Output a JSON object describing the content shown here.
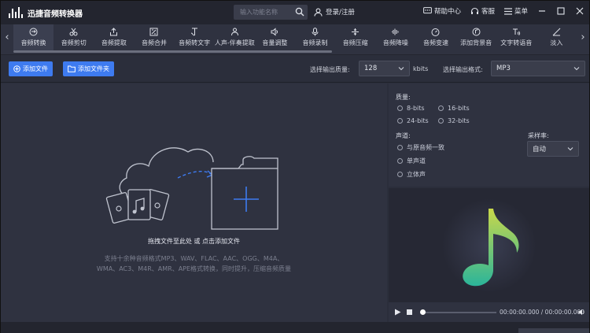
{
  "app": {
    "title": "迅捷音频转换器"
  },
  "search": {
    "placeholder": "输入功能名称"
  },
  "login": {
    "label": "登录/注册"
  },
  "titlebar": {
    "help": "帮助中心",
    "service": "客服",
    "menu": "菜单"
  },
  "tabs": [
    {
      "label": "音频转换",
      "icon": "convert-icon"
    },
    {
      "label": "音频剪切",
      "icon": "scissors-icon"
    },
    {
      "label": "音频提取",
      "icon": "extract-icon"
    },
    {
      "label": "音频合并",
      "icon": "merge-icon"
    },
    {
      "label": "音频转文字",
      "icon": "text-icon"
    },
    {
      "label": "人声-伴奏提取",
      "icon": "vocal-icon"
    },
    {
      "label": "音量调整",
      "icon": "volume-icon"
    },
    {
      "label": "音频录制",
      "icon": "mic-icon"
    },
    {
      "label": "音频压缩",
      "icon": "compress-icon"
    },
    {
      "label": "音频降噪",
      "icon": "denoise-icon"
    },
    {
      "label": "音频变速",
      "icon": "speed-icon"
    },
    {
      "label": "添加背景音",
      "icon": "bgm-icon"
    },
    {
      "label": "文字转语音",
      "icon": "tts-icon"
    },
    {
      "label": "淡入",
      "icon": "fade-icon"
    }
  ],
  "actions": {
    "add_file": "添加文件",
    "add_folder": "添加文件夹"
  },
  "output": {
    "quality_label": "选择输出质量:",
    "quality_value": "128",
    "quality_unit": "kbits",
    "format_label": "选择输出格式:",
    "format_value": "MP3"
  },
  "dropzone": {
    "hint": "拖拽文件至此处 或 点击添加文件",
    "desc_line1": "支持十余种音频格式MP3、WAV、FLAC、AAC、OGG、M4A、",
    "desc_line2": "WMA、AC3、M4R、AMR、APE格式转换，同时提升，压缩音频质量"
  },
  "settings": {
    "quality_title": "质量:",
    "quality_options": [
      "8-bits",
      "16-bits",
      "24-bits",
      "32-bits"
    ],
    "channel_title": "声道:",
    "channel_options": [
      "与原音频一致",
      "单声道",
      "立体声"
    ],
    "samplerate_title": "采样率:",
    "samplerate_value": "自动"
  },
  "player": {
    "time": "00:00:00.000 / 00:00:00.000"
  },
  "colors": {
    "accent": "#3e7bf0",
    "note_gradient_top": "#c9d84a",
    "note_gradient_bottom": "#2bb59a"
  }
}
